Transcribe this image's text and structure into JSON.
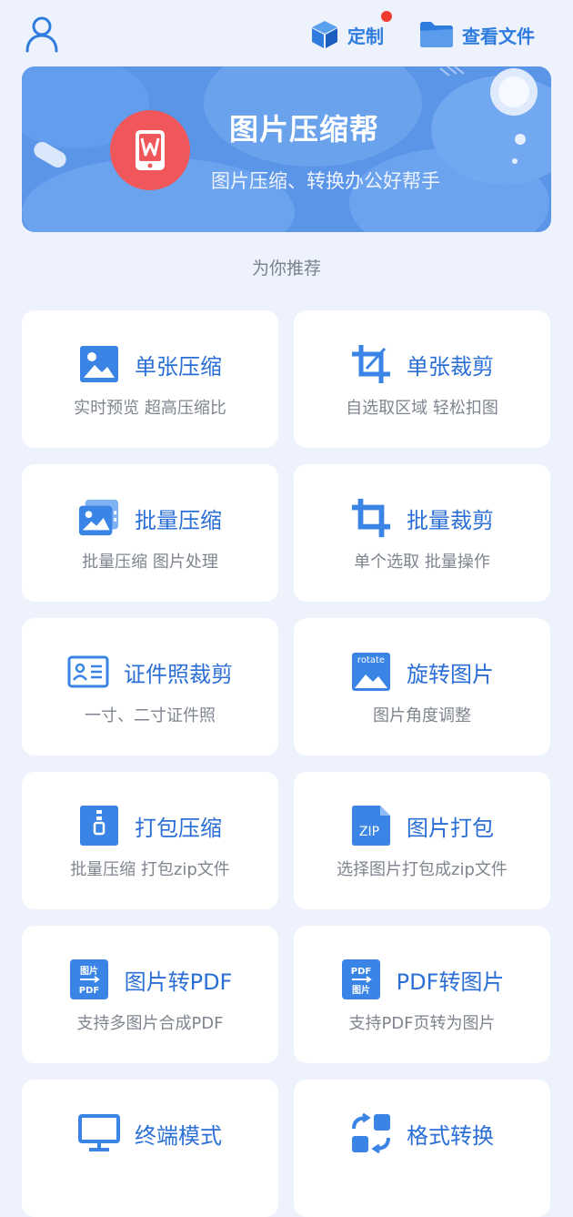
{
  "header": {
    "custom_label": "定制",
    "files_label": "查看文件"
  },
  "banner": {
    "title": "图片压缩帮",
    "slogan": "图片压缩、转换办公好帮手"
  },
  "section_title": "为你推荐",
  "tools": [
    {
      "title": "单张压缩",
      "subtitle": "实时预览  超高压缩比",
      "icon": "image-icon"
    },
    {
      "title": "单张裁剪",
      "subtitle": "自选取区域 轻松扣图",
      "icon": "crop-icon"
    },
    {
      "title": "批量压缩",
      "subtitle": "批量压缩 图片处理",
      "icon": "images-stack-icon"
    },
    {
      "title": "批量裁剪",
      "subtitle": "单个选取 批量操作",
      "icon": "batch-crop-icon"
    },
    {
      "title": "证件照裁剪",
      "subtitle": "一寸、二寸证件照",
      "icon": "id-card-icon"
    },
    {
      "title": "旋转图片",
      "subtitle": "图片角度调整",
      "icon": "rotate-image-icon",
      "icon_text": "rotate"
    },
    {
      "title": "打包压缩",
      "subtitle": "批量压缩 打包zip文件",
      "icon": "zip-archive-icon"
    },
    {
      "title": "图片打包",
      "subtitle": "选择图片打包成zip文件",
      "icon": "zip-file-icon",
      "icon_text": "ZIP"
    },
    {
      "title": "图片转PDF",
      "subtitle": "支持多图片合成PDF",
      "icon": "image-to-pdf-icon",
      "icon_text": [
        "图片",
        "PDF"
      ]
    },
    {
      "title": "PDF转图片",
      "subtitle": "支持PDF页转为图片",
      "icon": "pdf-to-image-icon",
      "icon_text": [
        "PDF",
        "图片"
      ]
    },
    {
      "title": "终端模式",
      "subtitle": "",
      "icon": "monitor-icon"
    },
    {
      "title": "格式转换",
      "subtitle": "",
      "icon": "format-convert-icon"
    }
  ],
  "colors": {
    "accent": "#2f7cdf",
    "title_blue": "#2b6fd6",
    "banner": "#5b95e8",
    "logo_red": "#f0575b",
    "badge_red": "#f23a2f",
    "background": "#eef2fd"
  }
}
